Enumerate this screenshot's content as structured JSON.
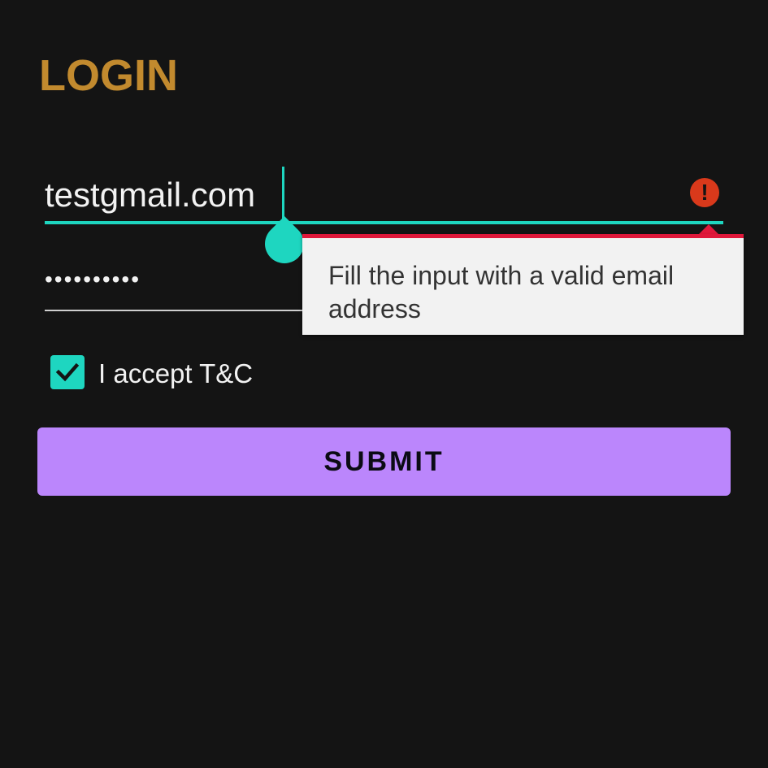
{
  "page": {
    "title": "LOGIN"
  },
  "email": {
    "value": "testgmail.com",
    "error_icon": "exclamation-icon",
    "error_message": "Fill the input with a valid email address"
  },
  "password": {
    "masked_value": "••••••••••"
  },
  "terms": {
    "checked": true,
    "label": "I accept T&C"
  },
  "submit": {
    "label": "SUBMIT"
  },
  "colors": {
    "background": "#141414",
    "title": "#c28a2e",
    "accent": "#1ed6c0",
    "error": "#e0173a",
    "error_icon": "#d9391b",
    "button": "#bb86fc"
  }
}
